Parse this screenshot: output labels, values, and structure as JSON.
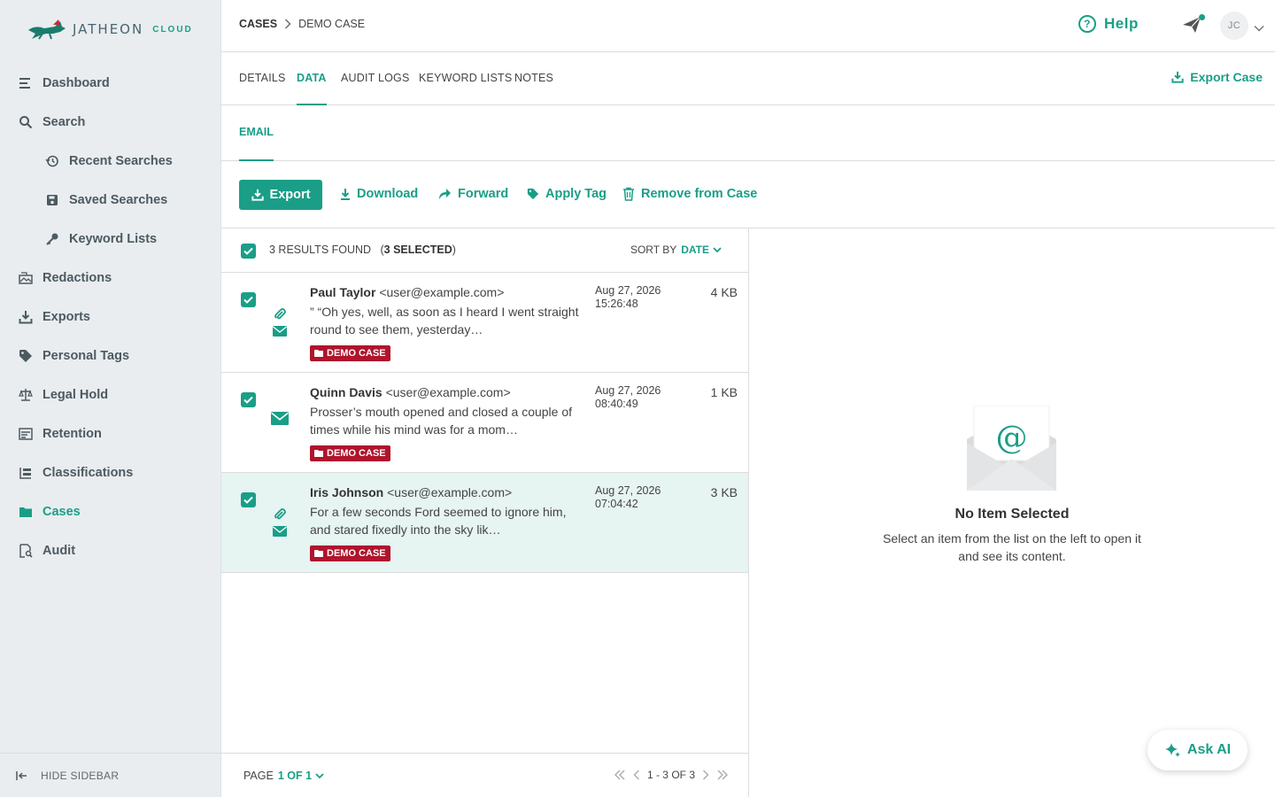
{
  "app": {
    "logo_text": "JATHEON",
    "logo_sub": "CLOUD"
  },
  "sidebar": {
    "items": [
      {
        "label": "Dashboard",
        "icon": "dashboard-icon"
      },
      {
        "label": "Search",
        "icon": "search-icon"
      },
      {
        "label": "Recent Searches",
        "icon": "history-icon"
      },
      {
        "label": "Saved Searches",
        "icon": "save-icon"
      },
      {
        "label": "Keyword Lists",
        "icon": "key-icon"
      },
      {
        "label": "Redactions",
        "icon": "redactions-icon"
      },
      {
        "label": "Exports",
        "icon": "download-icon"
      },
      {
        "label": "Personal Tags",
        "icon": "tag-icon"
      },
      {
        "label": "Legal Hold",
        "icon": "scale-icon"
      },
      {
        "label": "Retention",
        "icon": "retention-icon"
      },
      {
        "label": "Classifications",
        "icon": "classifications-icon"
      },
      {
        "label": "Cases",
        "icon": "folder-icon"
      },
      {
        "label": "Audit",
        "icon": "audit-icon"
      }
    ],
    "hide_label": "HIDE SIDEBAR"
  },
  "header": {
    "breadcrumb_root": "CASES",
    "breadcrumb_current": "DEMO CASE",
    "help_label": "Help",
    "avatar_initials": "JC"
  },
  "tabs": {
    "items": [
      "DETAILS",
      "DATA",
      "AUDIT LOGS",
      "KEYWORD LISTS",
      "NOTES"
    ],
    "export_case_label": "Export Case",
    "subtab": "EMAIL"
  },
  "actions": {
    "export": "Export",
    "download": "Download",
    "forward": "Forward",
    "apply_tag": "Apply Tag",
    "remove": "Remove from Case"
  },
  "list": {
    "results_text": "3 RESULTS FOUND",
    "selected_text": "3 SELECTED",
    "sort_label": "SORT BY",
    "sort_value": "DATE",
    "rows": [
      {
        "name": "Paul Taylor",
        "email": "<user@example.com>",
        "preview": "” “Oh yes, well, as soon as I heard I went straight round to see them, yesterday…",
        "tag": "DEMO CASE",
        "date": "Aug 27, 2026",
        "time": "15:26:48",
        "size": "4 KB",
        "attachment": true
      },
      {
        "name": "Quinn Davis",
        "email": "<user@example.com>",
        "preview": "Prosser’s mouth opened and closed a couple of times while his mind was for a mom…",
        "tag": "DEMO CASE",
        "date": "Aug 27, 2026",
        "time": "08:40:49",
        "size": "1 KB",
        "attachment": false
      },
      {
        "name": "Iris Johnson",
        "email": "<user@example.com>",
        "preview": "For a few seconds Ford seemed to ignore him, and stared fixedly into the sky lik…",
        "tag": "DEMO CASE",
        "date": "Aug 27, 2026",
        "time": "07:04:42",
        "size": "3 KB",
        "attachment": true
      }
    ],
    "page_label": "PAGE",
    "page_value": "1 OF 1",
    "range": "1 - 3 OF 3"
  },
  "preview": {
    "title": "No Item Selected",
    "subtitle": "Select an item from the list on the left to open it and see its content."
  },
  "ask_ai": "Ask AI",
  "colors": {
    "accent": "#1a9e87",
    "badge": "#b0142d",
    "sidebar_bg": "#e9edf0",
    "selected_row": "#e6f4f2"
  }
}
